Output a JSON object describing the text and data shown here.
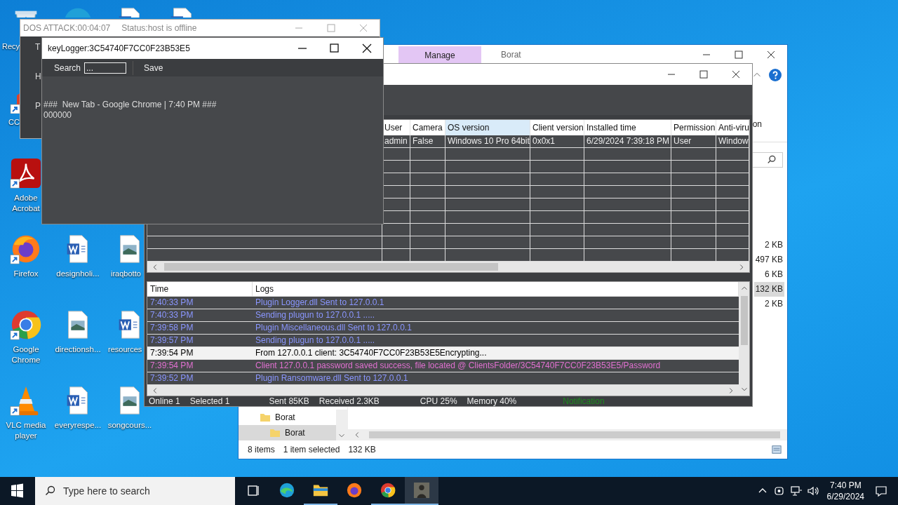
{
  "desktop_icons": [
    {
      "kind": "recycle",
      "label": "Recy"
    },
    {
      "kind": "edge"
    },
    {
      "kind": "word"
    },
    {
      "kind": "word"
    },
    {
      "kind": "tool",
      "label": "CC",
      "shortcut": true
    },
    {
      "kind": "acrobat",
      "label": "Adobe Acrobat",
      "shortcut": true
    },
    {
      "kind": "firefox",
      "label": "Firefox",
      "shortcut": true
    },
    {
      "kind": "word",
      "label": "designholi...",
      "shortcut": false
    },
    {
      "kind": "image",
      "label": "iraqbotto",
      "shortcut": false
    },
    {
      "kind": "chrome",
      "label": "Google Chrome",
      "shortcut": true
    },
    {
      "kind": "image",
      "label": "directionsh...",
      "shortcut": false
    },
    {
      "kind": "word",
      "label": "resources",
      "shortcut": false
    },
    {
      "kind": "vlc",
      "label": "VLC media player",
      "shortcut": true
    },
    {
      "kind": "word",
      "label": "everyrespe...",
      "shortcut": false
    },
    {
      "kind": "image",
      "label": "songcours...",
      "shortcut": false
    }
  ],
  "explorer_window": {
    "ribbon_tab": "Manage",
    "title": "Borat",
    "partial_label": "on",
    "file_sizes": [
      {
        "size": "2 KB",
        "selected": false
      },
      {
        "size": "497 KB",
        "selected": false
      },
      {
        "size": "6 KB",
        "selected": false
      },
      {
        "size": "132 KB",
        "selected": true
      },
      {
        "size": "2 KB",
        "selected": false
      }
    ],
    "tree": [
      {
        "label": "Borat",
        "selected": false
      },
      {
        "label": "Borat",
        "selected": true
      }
    ],
    "status_bar": {
      "items": "8 items",
      "selection": "1 item selected",
      "size": "132 KB"
    }
  },
  "main_window": {
    "clients_table": {
      "columns": [
        {
          "label": "User",
          "selected": false
        },
        {
          "label": "Camera",
          "selected": false
        },
        {
          "label": "OS version",
          "selected": true
        },
        {
          "label": "Client version",
          "selected": false
        },
        {
          "label": "Installed time",
          "selected": false
        },
        {
          "label": "Permission",
          "selected": false
        },
        {
          "label": "Anti-viru",
          "selected": false
        }
      ],
      "rows": [
        [
          "admin",
          "False",
          "Windows 10 Pro 64bit",
          "0x0x1",
          "6/29/2024 7:39:18 PM",
          "User",
          "Window"
        ]
      ]
    },
    "logs": {
      "columns": [
        "Time",
        "Logs"
      ],
      "rows": [
        {
          "time": "7:40:33 PM",
          "message": "Plugin Logger.dll Sent to 127.0.0.1",
          "color": "#8a96ff",
          "selected": false
        },
        {
          "time": "7:40:33 PM",
          "message": "Sending plugun to 127.0.0.1 .....",
          "color": "#8a96ff",
          "selected": false
        },
        {
          "time": "7:39:58 PM",
          "message": "Plugin Miscellaneous.dll Sent to 127.0.0.1",
          "color": "#8a96ff",
          "selected": false
        },
        {
          "time": "7:39:57 PM",
          "message": "Sending plugun to 127.0.0.1 .....",
          "color": "#8a96ff",
          "selected": false
        },
        {
          "time": "7:39:54 PM",
          "message": "From 127.0.0.1 client: 3C54740F7CC0F23B53E5Encrypting...",
          "color": "#000000",
          "selected": true
        },
        {
          "time": "7:39:54 PM",
          "message": "Client 127.0.0.1 password saved success, file located @ ClientsFolder/3C54740F7CC0F23B53E5/Password",
          "color": "#e070d0",
          "selected": false
        },
        {
          "time": "7:39:52 PM",
          "message": "Plugin Ransomware.dll Sent to 127.0.0.1",
          "color": "#8a96ff",
          "selected": false
        }
      ]
    },
    "status_bar": {
      "online": "Online 1",
      "selected": "Selected 1",
      "sent": "Sent 85KB",
      "received": "Received  2.3KB",
      "cpu": "CPU 25%",
      "memory": "Memory 40%",
      "notification": "Notification"
    }
  },
  "dos_window": {
    "title": "DOS ATTACK:00:04:07",
    "status": "Status:host is offline",
    "side_labels": [
      "T",
      "H",
      "P"
    ]
  },
  "keylogger_window": {
    "title": "keyLogger:3C54740F7CC0F23B53E5",
    "search_label": "Search",
    "search_value": "...",
    "save": "Save",
    "lines": [
      "###  New Tab - Google Chrome | 7:40 PM ###",
      "000000"
    ]
  },
  "taskbar": {
    "search_placeholder": "Type here to search",
    "apps": [
      {
        "kind": "edge",
        "running": false,
        "selected": false
      },
      {
        "kind": "explorer",
        "running": true,
        "selected": false
      },
      {
        "kind": "firefox",
        "running": false,
        "selected": false
      },
      {
        "kind": "chrome",
        "running": true,
        "selected": false
      },
      {
        "kind": "app",
        "running": true,
        "selected": true
      }
    ],
    "time": "7:40 PM",
    "date": "6/29/2024"
  }
}
